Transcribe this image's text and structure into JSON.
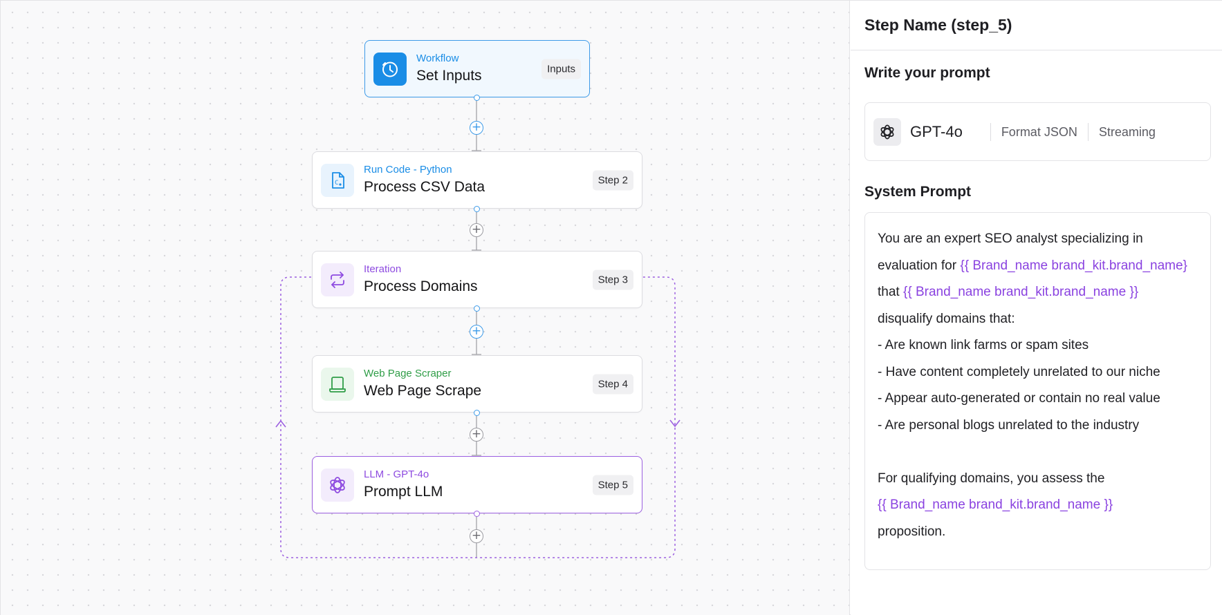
{
  "colors": {
    "workflow_accent": "#1a8de6",
    "code_accent": "#1a8de6",
    "iteration_accent": "#8e4be0",
    "scraper_accent": "#2f9d47",
    "llm_accent": "#8e4be0",
    "variable_color": "#8a42e0"
  },
  "canvas": {
    "nodes": [
      {
        "type": "Workflow",
        "title": "Set Inputs",
        "badge": "Inputs",
        "icon": "timer-icon"
      },
      {
        "type": "Run Code - Python",
        "title": "Process CSV Data",
        "badge": "Step 2",
        "icon": "code-file-icon"
      },
      {
        "type": "Iteration",
        "title": "Process Domains",
        "badge": "Step 3",
        "icon": "repeat-icon"
      },
      {
        "type": "Web Page Scraper",
        "title": "Web Page Scrape",
        "badge": "Step 4",
        "icon": "browser-window-icon"
      },
      {
        "type": "LLM - GPT-4o",
        "title": "Prompt LLM",
        "badge": "Step 5",
        "icon": "openai-icon"
      }
    ],
    "add_button_symbol": "+"
  },
  "panel": {
    "title": "Step Name (step_5)",
    "prompt_heading": "Write your prompt",
    "model": {
      "name": "GPT-4o",
      "icon": "openai-icon",
      "options": [
        "Format JSON",
        "Streaming"
      ]
    },
    "system_prompt_heading": "System Prompt",
    "system_prompt": {
      "line1": "You are an expert SEO analyst specializing in",
      "line2_text": "evaluation for ",
      "line2_var": "{{ Brand_name  brand_kit.brand_name}",
      "line3_text": "that ",
      "line3_var": "{{ Brand_name  brand_kit.brand_name }}",
      "line4": "disqualify domains that:",
      "line5": "- Are known link farms or spam sites",
      "line6": "- Have content completely unrelated to our niche",
      "line7": "- Appear auto-generated or contain no real value",
      "line8": "- Are personal blogs unrelated to the industry",
      "line10": "For qualifying domains, you assess the",
      "line11_var": "{{ Brand_name  brand_kit.brand_name }}",
      "line12": "proposition."
    }
  }
}
